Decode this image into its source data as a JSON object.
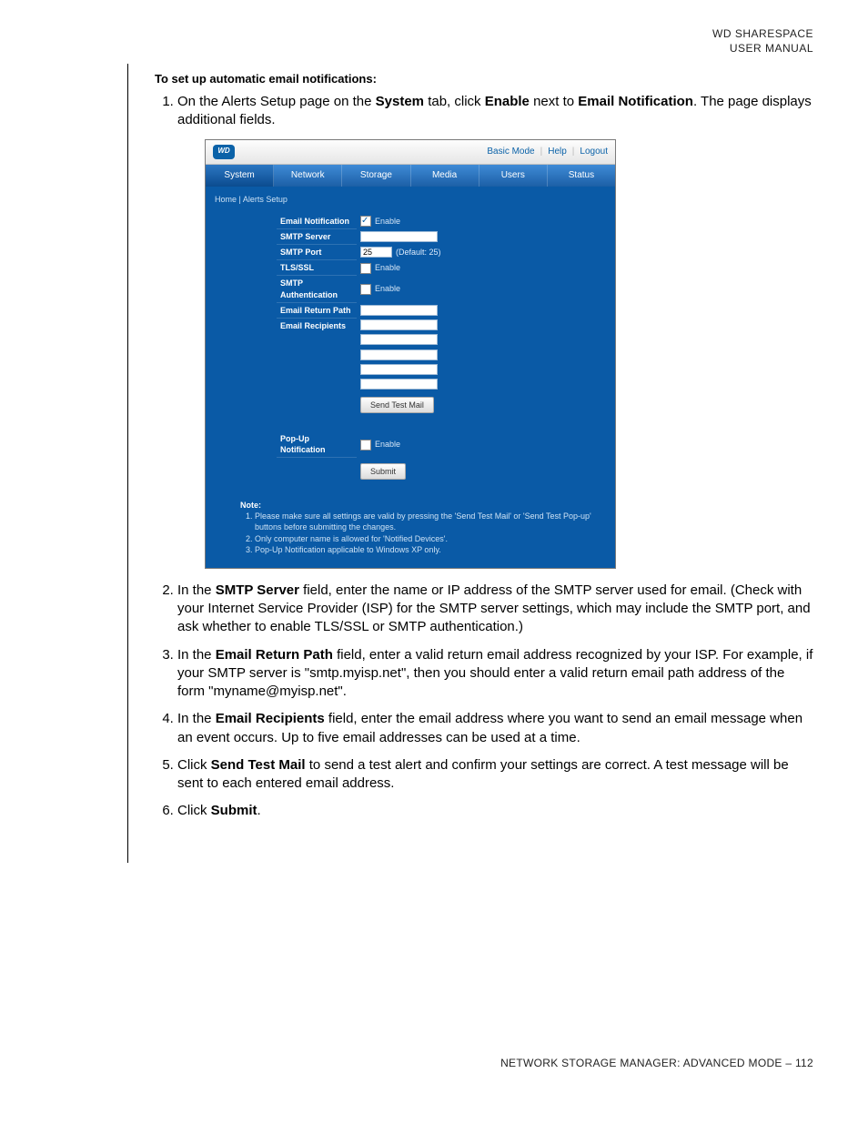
{
  "header": {
    "line1": "WD SHARESPACE",
    "line2": "USER MANUAL"
  },
  "section_title": "To set up automatic email notifications:",
  "steps": {
    "s1a": "On the Alerts Setup page on the ",
    "s1_system": "System",
    "s1b": " tab, click ",
    "s1_enable": "Enable",
    "s1c": " next to ",
    "s1_email": "Email Notification",
    "s1d": ". The page displays additional fields.",
    "s2a": "In the ",
    "s2_bold": "SMTP Server",
    "s2b": " field, enter the name or IP address of the SMTP server used for email. (Check with your Internet Service Provider (ISP) for the SMTP server settings, which may include the SMTP port, and ask whether to enable TLS/SSL or SMTP authentication.)",
    "s3a": "In the ",
    "s3_bold": "Email Return Path",
    "s3b": " field, enter a valid return email address recognized by your ISP. For example, if your SMTP server is \"smtp.myisp.net\", then you should enter a valid return email path address of the form \"myname@myisp.net\".",
    "s4a": "In the ",
    "s4_bold": "Email Recipients",
    "s4b": " field, enter the email address where you want to send an email message when an event occurs. Up to five email addresses can be used at a time.",
    "s5a": "Click ",
    "s5_bold": "Send Test Mail",
    "s5b": " to send a test alert and confirm your settings are correct. A test message will be sent to each entered email address.",
    "s6a": "Click ",
    "s6_bold": "Submit",
    "s6b": "."
  },
  "shot": {
    "logo": "WD",
    "toplinks": {
      "basic": "Basic Mode",
      "help": "Help",
      "logout": "Logout"
    },
    "tabs": [
      "System",
      "Network",
      "Storage",
      "Media",
      "Users",
      "Status"
    ],
    "breadcrumb": "Home | Alerts Setup",
    "labels": {
      "email_notif": "Email Notification",
      "smtp_server": "SMTP Server",
      "smtp_port": "SMTP Port",
      "tls": "TLS/SSL",
      "auth": "SMTP Authentication",
      "return_path": "Email Return Path",
      "recipients": "Email Recipients",
      "popup": "Pop-Up Notification"
    },
    "enable": "Enable",
    "port_val": "25",
    "port_hint": "(Default: 25)",
    "btn_test": "Send Test Mail",
    "btn_submit": "Submit",
    "note_title": "Note:",
    "notes": [
      "Please make sure all settings are valid by pressing the 'Send Test Mail' or 'Send Test Pop-up' buttons before submitting the changes.",
      "Only computer name is allowed for 'Notified Devices'.",
      "Pop-Up Notification applicable to Windows XP only."
    ]
  },
  "footer": {
    "text": "NETWORK STORAGE MANAGER: ADVANCED MODE – 112"
  }
}
